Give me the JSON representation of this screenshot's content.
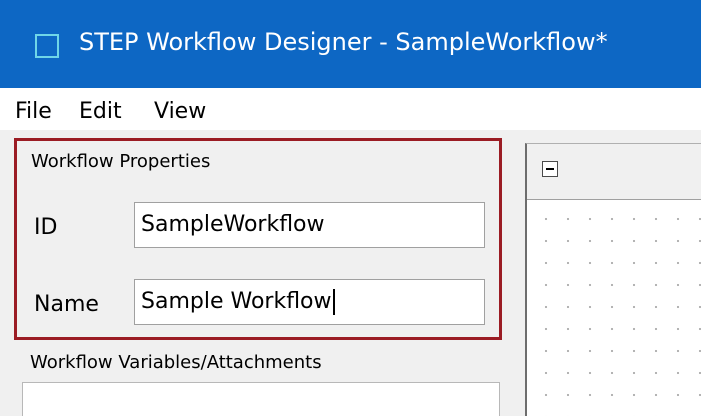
{
  "window": {
    "title": "STEP Workflow Designer - SampleWorkflow*"
  },
  "menubar": {
    "items": [
      "File",
      "Edit",
      "View"
    ]
  },
  "workflow_properties": {
    "group_title": "Workflow Properties",
    "id_label": "ID",
    "id_value": "SampleWorkflow",
    "name_label": "Name",
    "name_value": "Sample Workflow"
  },
  "variables": {
    "label": "Workflow Variables/Attachments"
  },
  "icons": {
    "app": "workflow-app-icon",
    "collapse": "collapse-minus-icon"
  },
  "colors": {
    "titlebar": "#0d67c4",
    "highlight_border": "#9b1c24"
  }
}
